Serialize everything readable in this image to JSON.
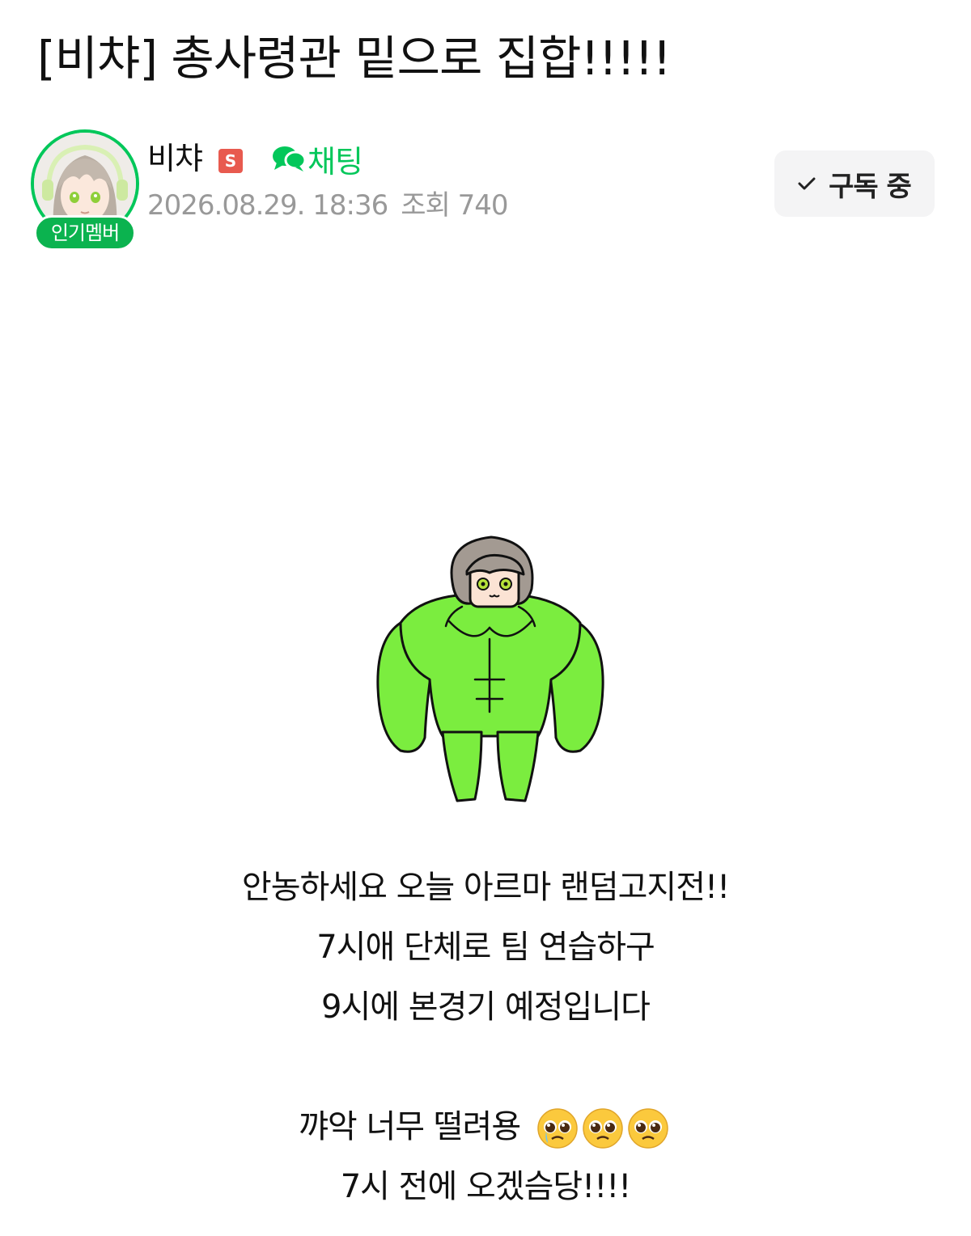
{
  "post": {
    "title": "[비챠] 총사령관 밑으로 집합!!!!!"
  },
  "author": {
    "name": "비챠",
    "staff_badge": "S",
    "popular_badge": "인기멤버",
    "avatar_icon": "avatar-anime-girl-icon"
  },
  "chat": {
    "label": "채팅",
    "icon": "chat-bubbles-icon"
  },
  "meta": {
    "date": "2026.08.29. 18:36",
    "views_label": "조회",
    "views_count": "740"
  },
  "subscribe": {
    "label": "구독 중",
    "icon": "check-icon"
  },
  "content": {
    "image_icon": "muscular-green-character-icon",
    "lines": [
      "안농하세요 오늘 아르마 랜덤고지전!!",
      "7시애 단체로 팀 연습하구",
      "9시에 본경기 예정입니다",
      "",
      "꺄악 너무 떨려용",
      "7시 전에 오겠슴당!!!!"
    ],
    "emoji": "pleading-face-emoji"
  },
  "colors": {
    "brand_green": "#03c75a",
    "meta_gray": "#999999",
    "staff_red": "#e85a4f",
    "button_bg": "#f4f4f5",
    "character_green": "#7bed3f"
  }
}
